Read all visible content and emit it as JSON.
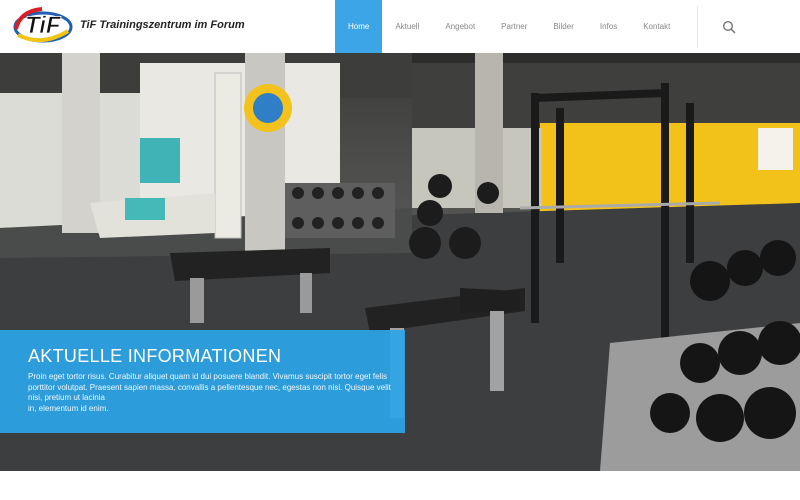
{
  "header": {
    "logo_text": "TiF",
    "site_title": "TiF Trainingszentrum im Forum"
  },
  "nav": {
    "items": [
      {
        "label": "Home",
        "active": true
      },
      {
        "label": "Aktuell",
        "active": false
      },
      {
        "label": "Angebot",
        "active": false
      },
      {
        "label": "Partner",
        "active": false
      },
      {
        "label": "Bilder",
        "active": false
      },
      {
        "label": "Infos",
        "active": false
      },
      {
        "label": "Kontakt",
        "active": false
      }
    ],
    "search_icon": "search-icon"
  },
  "hero": {
    "image": "gym-interior-photo",
    "info_title": "AKTUELLE INFORMATIONEN",
    "info_text": "Proin eget tortor risus. Curabitur aliquet quam id dui posuere blandit. Vivamus suscipit tortor eget felis porttitor volutpat. Praesent sapien massa, convallis a pellentesque nec, egestas non nisi. Quisque velit nisi, pretium ut lacinia\n in, elementum id enim."
  },
  "colors": {
    "accent": "#3ba5e8",
    "info_box": "#2ca4e6",
    "wall_yellow": "#f2c21b"
  }
}
